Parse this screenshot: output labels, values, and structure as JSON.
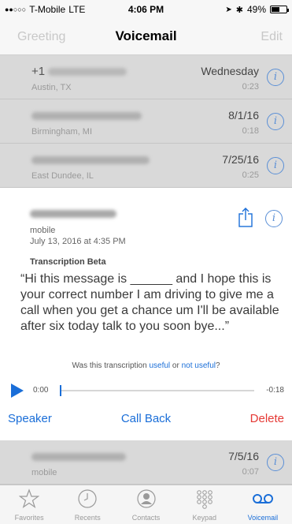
{
  "status_bar": {
    "carrier": "T-Mobile",
    "network": "LTE",
    "time": "4:06 PM",
    "battery": "49%",
    "battery_level": 0.49
  },
  "nav": {
    "left": "Greeting",
    "title": "Voicemail",
    "right": "Edit"
  },
  "voicemails": [
    {
      "caller": "+1",
      "location": "Austin, TX",
      "date": "Wednesday",
      "duration": "0:23"
    },
    {
      "caller": "",
      "location": "Birmingham, MI",
      "date": "8/1/16",
      "duration": "0:18"
    },
    {
      "caller": "",
      "location": "East Dundee, IL",
      "date": "7/25/16",
      "duration": "0:25"
    }
  ],
  "expanded": {
    "label": "mobile",
    "timestamp": "July 13, 2016 at 4:35 PM",
    "transcription_header": "Transcription Beta",
    "transcript": "“Hi this message is ______ and I hope this is your correct number I am driving to give me a call when you get a chance um I'll be available after six today talk to you soon bye...”",
    "feedback_prefix": "Was this transcription",
    "feedback_useful": "useful",
    "feedback_or": "or",
    "feedback_not_useful": "not useful",
    "feedback_suffix": "?",
    "time_elapsed": "0:00",
    "time_remaining": "-0:18",
    "speaker": "Speaker",
    "call_back": "Call Back",
    "delete": "Delete"
  },
  "voicemails_after": [
    {
      "label": "mobile",
      "date": "7/5/16",
      "duration": "0:07"
    }
  ],
  "tabs": [
    {
      "label": "Favorites",
      "icon": "star-icon"
    },
    {
      "label": "Recents",
      "icon": "clock-icon"
    },
    {
      "label": "Contacts",
      "icon": "contact-icon"
    },
    {
      "label": "Keypad",
      "icon": "keypad-icon"
    },
    {
      "label": "Voicemail",
      "icon": "voicemail-icon",
      "active": true
    }
  ],
  "colors": {
    "accent": "#1a6ed8",
    "delete": "#e53935",
    "dim_row": "#d9d9d9"
  }
}
